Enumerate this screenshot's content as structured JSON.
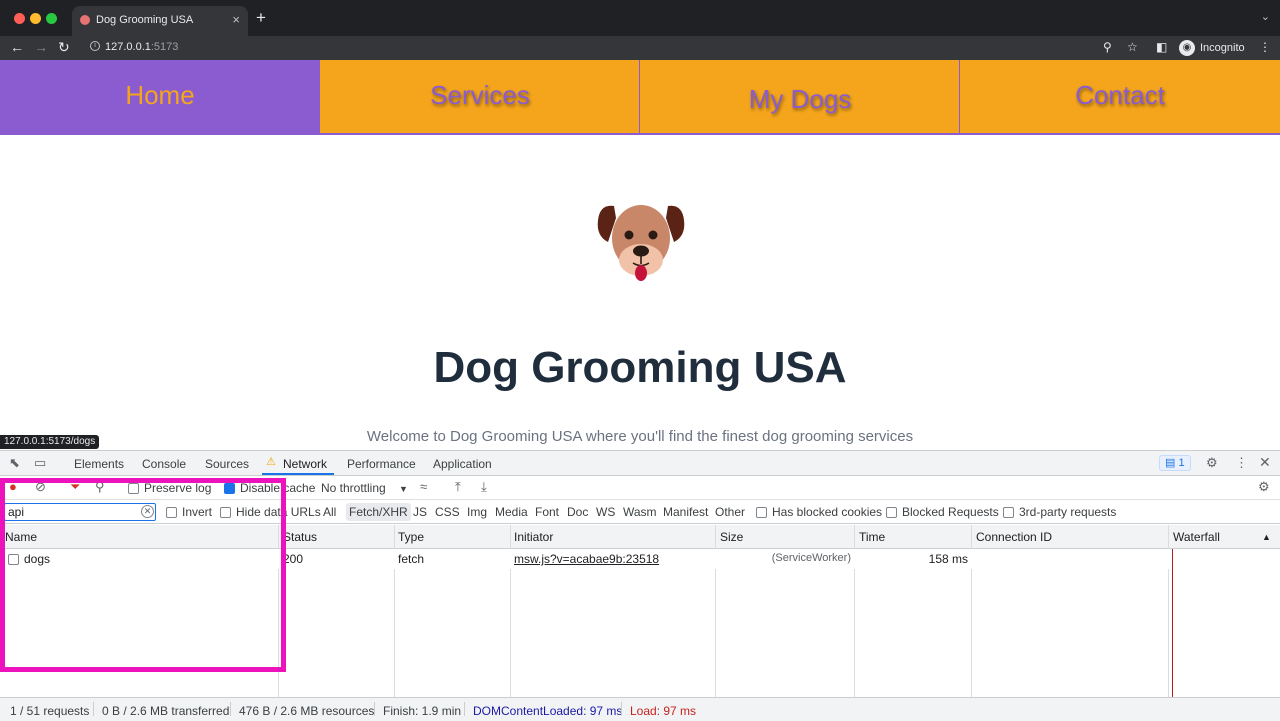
{
  "browser": {
    "tab_title": "Dog Grooming USA",
    "tab_close": "×",
    "new_tab": "+",
    "url_host": "127.0.0.1",
    "url_port": ":5173",
    "profile_label": "Incognito"
  },
  "site": {
    "nav": [
      "Home",
      "Services",
      "My Dogs",
      "Contact"
    ],
    "active_nav": "Home",
    "title": "Dog Grooming USA",
    "subtitle": "Welcome to Dog Grooming USA where you'll find the finest dog grooming services",
    "status_bar_url": "127.0.0.1:5173/dogs"
  },
  "devtools": {
    "tabs": [
      "Elements",
      "Console",
      "Sources",
      "Network",
      "Performance",
      "Application"
    ],
    "active_tab": "Network",
    "issues_count": "1",
    "toolbar": {
      "preserve_log": "Preserve log",
      "disable_cache": "Disable cache",
      "throttling": "No throttling"
    },
    "filter": {
      "value": "api",
      "invert": "Invert",
      "hide_data_urls": "Hide data URLs",
      "types": [
        "All",
        "Fetch/XHR",
        "JS",
        "CSS",
        "Img",
        "Media",
        "Font",
        "Doc",
        "WS",
        "Wasm",
        "Manifest",
        "Other"
      ],
      "active_type": "Fetch/XHR",
      "has_blocked_cookies": "Has blocked cookies",
      "blocked_requests": "Blocked Requests",
      "third_party": "3rd-party requests"
    },
    "columns": [
      "Name",
      "Status",
      "Type",
      "Initiator",
      "Size",
      "Time",
      "Connection ID",
      "Waterfall"
    ],
    "rows": [
      {
        "name": "dogs",
        "status": "200",
        "type": "fetch",
        "initiator": "msw.js?v=acabae9b:23518",
        "size": "(ServiceWorker)",
        "time": "158 ms",
        "connection_id": ""
      }
    ],
    "status": {
      "requests": "1 / 51 requests",
      "transferred": "0 B / 2.6 MB transferred",
      "resources": "476 B / 2.6 MB resources",
      "finish": "Finish: 1.9 min",
      "dom_content_loaded": "DOMContentLoaded: 97 ms",
      "load": "Load: 97 ms"
    }
  },
  "colors": {
    "nav_orange": "#f4a51c",
    "nav_purple": "#8a5cd0",
    "highlight_magenta": "#ec12bc",
    "dcl_blue": "#1a1aa6",
    "load_red": "#c5221f"
  },
  "icons": [
    "back-arrow-icon",
    "forward-arrow-icon",
    "reload-icon",
    "zoom-icon",
    "star-icon",
    "sidebar-icon",
    "kebab-icon",
    "inspect-icon",
    "device-icon",
    "warning-icon",
    "gear-icon",
    "close-icon",
    "record-icon",
    "clear-icon",
    "filter-icon",
    "search-icon",
    "wifi-icon",
    "upload-icon",
    "download-icon"
  ]
}
